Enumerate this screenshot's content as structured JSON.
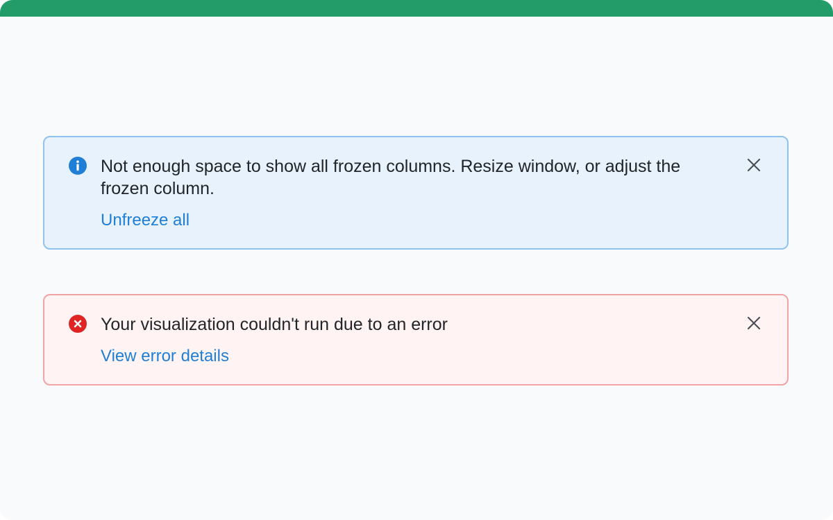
{
  "info_alert": {
    "icon": "info-icon",
    "message": "Not enough space to show all frozen columns. Resize window, or adjust the frozen column.",
    "action_label": "Unfreeze all",
    "close_icon": "close-icon",
    "colors": {
      "background": "#e7f2fc",
      "border": "#8fc2ef",
      "icon": "#1f7fd6"
    }
  },
  "error_alert": {
    "icon": "error-icon",
    "message": "Your visualization couldn't run due to an error",
    "action_label": "View error details",
    "close_icon": "close-icon",
    "colors": {
      "background": "#fff3f3",
      "border": "#f1a4a6",
      "icon": "#e02424"
    }
  },
  "theme": {
    "accent_bar": "#239c6a",
    "link": "#1f7fd6",
    "text": "#212529"
  }
}
